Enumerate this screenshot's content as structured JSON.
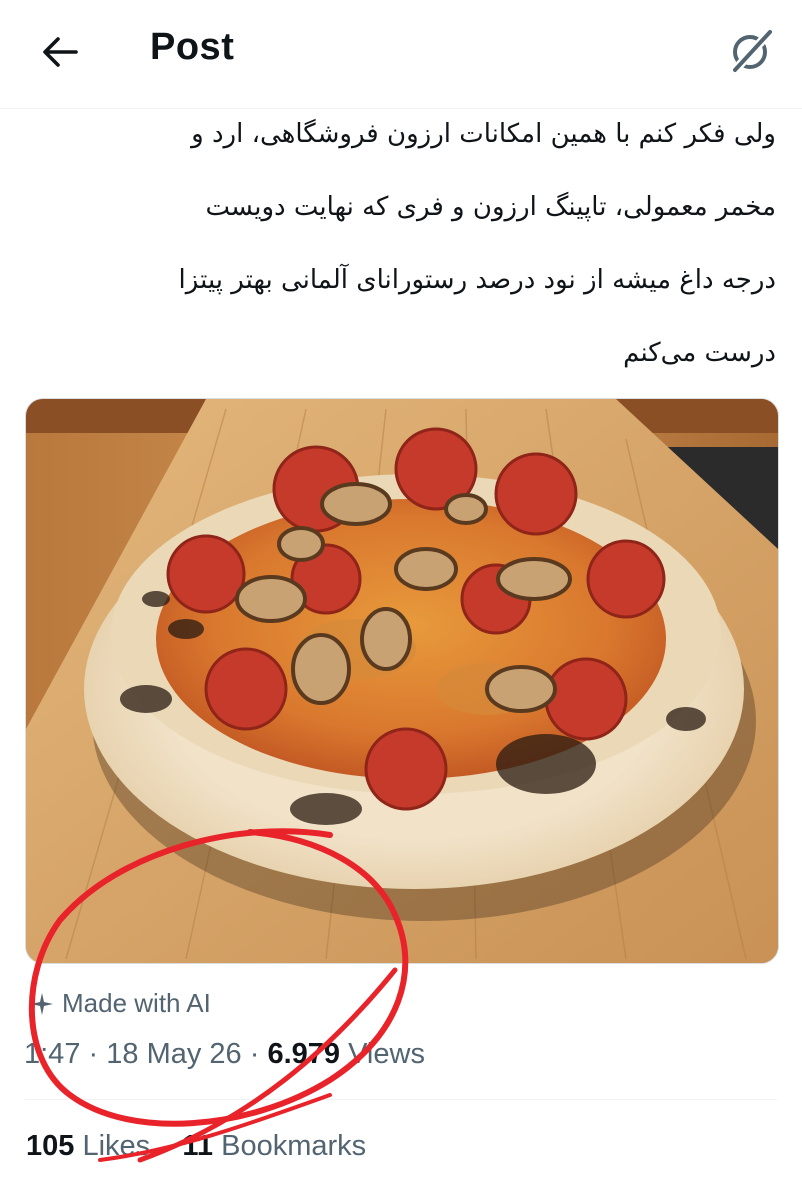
{
  "header": {
    "title": "Post",
    "back_icon": "arrow-left-icon",
    "grok_icon": "grok-icon"
  },
  "post": {
    "lines": [
      "ولی فکر کنم با همین امکانات ارزون فروشگاهی، ارد و",
      "مخمر معمولی، تاپینگ ارزون و فری که نهایت دویست",
      "درجه داغ میشه از نود درصد رستورانای آلمانی بهتر پیتزا",
      "درست می‌کنم"
    ],
    "media_alt": "pizza-image",
    "ai_label": "Made with AI",
    "time": "1:47",
    "date": "18 May 26",
    "separator": "·",
    "views_count": "6.979",
    "views_label": "Views",
    "likes_count": "105",
    "likes_label": "Likes",
    "bookmarks_count": "11",
    "bookmarks_label": "Bookmarks"
  },
  "colors": {
    "text": "#0f1419",
    "secondary": "#536471",
    "annotation": "#e8232a"
  }
}
